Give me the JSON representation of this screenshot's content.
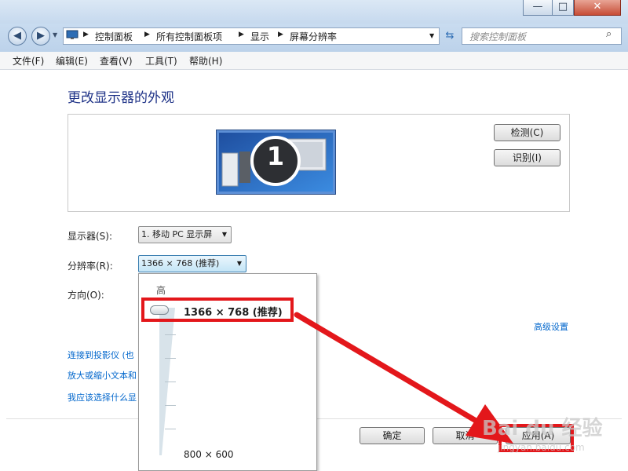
{
  "window": {
    "caption_buttons": {
      "minimize": "—",
      "maximize": "□",
      "close": "✕"
    }
  },
  "navigation": {
    "back_icon": "arrow-left-icon",
    "forward_icon": "arrow-right-icon",
    "breadcrumbs": [
      "控制面板",
      "所有控制面板项",
      "显示",
      "屏幕分辨率"
    ],
    "search_placeholder": "搜索控制面板"
  },
  "menu": [
    "文件(F)",
    "编辑(E)",
    "查看(V)",
    "工具(T)",
    "帮助(H)"
  ],
  "page": {
    "title": "更改显示器的外观",
    "monitor_number": "1",
    "detect_button": "检测(C)",
    "identify_button": "识别(I)",
    "display_label": "显示器(S):",
    "display_value": "1. 移动 PC 显示屏",
    "resolution_label": "分辨率(R):",
    "resolution_value": "1366 × 768 (推荐)",
    "orientation_label": "方向(O):",
    "advanced_link": "高级设置",
    "links": [
      "连接到投影仪 (也",
      "放大或缩小文本和",
      "我应该选择什么显"
    ],
    "ok_button": "确定",
    "cancel_button": "取消",
    "apply_button": "应用(A)"
  },
  "dropdown": {
    "high_label": "高",
    "selected": "1366 × 768 (推荐)",
    "low_label": "800 × 600",
    "slider_position": 1.0
  },
  "annotation": {
    "color": "#e3171b"
  },
  "watermark": {
    "brand": "Bai du 经验",
    "url": "jingyan.baidu.com"
  }
}
